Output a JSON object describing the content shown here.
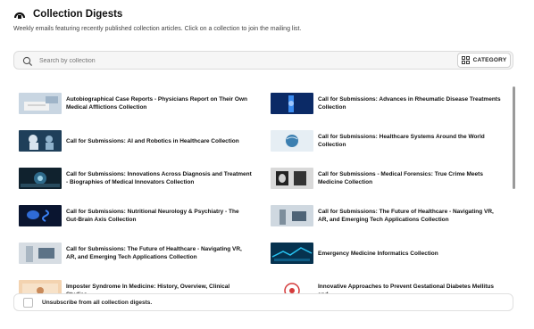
{
  "header": {
    "title": "Collection Digests",
    "subtitle": "Weekly emails featuring recently published collection articles. Click on a collection to join the mailing list."
  },
  "search": {
    "placeholder": "Search by collection",
    "icon": "search-icon"
  },
  "category_button": {
    "label": "CATEGORY",
    "icon": "grid-icon"
  },
  "collections": [
    {
      "label": "Autobiographical Case Reports - Physicians Report on Their Own Medical Afflictions Collection"
    },
    {
      "label": "Call for Submissions: Advances in Rheumatic Disease Treatments Collection"
    },
    {
      "label": "Call for Submissions: AI and Robotics in Healthcare Collection"
    },
    {
      "label": "Call for Submissions: Healthcare Systems Around the World Collection"
    },
    {
      "label": "Call for Submissions: Innovations Across Diagnosis and Treatment - Biographies of Medical Innovators Collection"
    },
    {
      "label": "Call for Submissions - Medical Forensics: True Crime Meets Medicine Collection"
    },
    {
      "label": "Call for Submissions: Nutritional Neurology & Psychiatry - The Gut-Brain Axis Collection"
    },
    {
      "label": "Call for Submissions: The Future of Healthcare - Navigating VR, AR, and Emerging Tech Applications Collection"
    },
    {
      "label": "Call for Submissions: The Future of Healthcare - Navigating VR, AR, and Emerging Tech Applications Collection"
    },
    {
      "label": "Emergency Medicine Informatics Collection"
    },
    {
      "label": "Imposter Syndrome In Medicine: History, Overview, Clinical Studies,"
    },
    {
      "label": "Innovative Approaches to Prevent Gestational Diabetes Mellitus and"
    }
  ],
  "footer": {
    "unsubscribe_label": "Unsubscribe from all collection digests."
  },
  "colors": {
    "accent": "#1a1a1a",
    "border": "#dcdcdc",
    "search_bg": "#f6f6f6"
  }
}
